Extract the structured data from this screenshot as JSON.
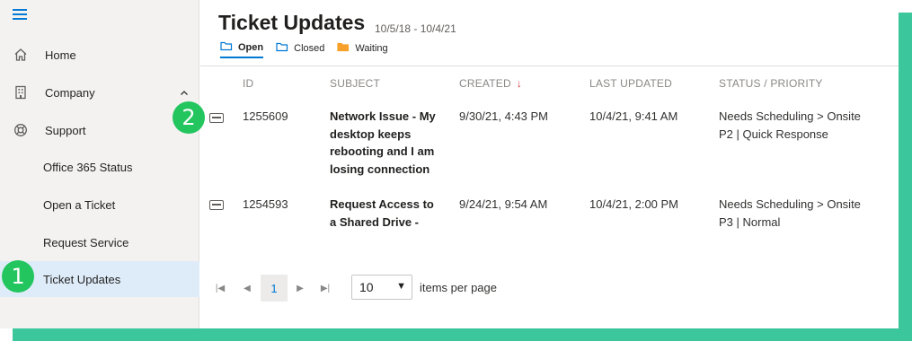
{
  "sidebar": {
    "items": [
      {
        "label": "Home",
        "icon": "home-icon"
      },
      {
        "label": "Company",
        "icon": "building-icon"
      },
      {
        "label": "Support",
        "icon": "lifebuoy-icon"
      },
      {
        "label": "Office 365 Status"
      },
      {
        "label": "Open a Ticket"
      },
      {
        "label": "Request Service"
      },
      {
        "label": "Ticket Updates",
        "active": true
      }
    ]
  },
  "badges": {
    "one": "1",
    "two": "2"
  },
  "page": {
    "title": "Ticket Updates",
    "date_range": "10/5/18 - 10/4/21",
    "filters": [
      {
        "label": "Open",
        "active": true
      },
      {
        "label": "Closed"
      },
      {
        "label": "Waiting"
      }
    ]
  },
  "table": {
    "columns": [
      "ID",
      "SUBJECT",
      "CREATED",
      "LAST UPDATED",
      "STATUS / PRIORITY"
    ],
    "rows": [
      {
        "id": "1255609",
        "subject": "Network Issue - My desktop keeps rebooting and I am losing connection",
        "created": "9/30/21, 4:43 PM",
        "updated": "10/4/21, 9:41 AM",
        "status": "Needs Scheduling > Onsite",
        "priority": "P2 | Quick Response"
      },
      {
        "id": "1254593",
        "subject": "Request Access to a Shared Drive -",
        "created": "9/24/21, 9:54 AM",
        "updated": "10/4/21, 2:00 PM",
        "status": "Needs Scheduling > Onsite",
        "priority": "P3 | Normal"
      }
    ]
  },
  "pager": {
    "current_page": "1",
    "page_size": "10",
    "page_size_label": "items per page"
  },
  "colors": {
    "accent": "#0078d4",
    "frame": "#3cc69c",
    "badge": "#22c55e",
    "sort": "#d13438",
    "folder_waiting": "#f7a12b"
  }
}
